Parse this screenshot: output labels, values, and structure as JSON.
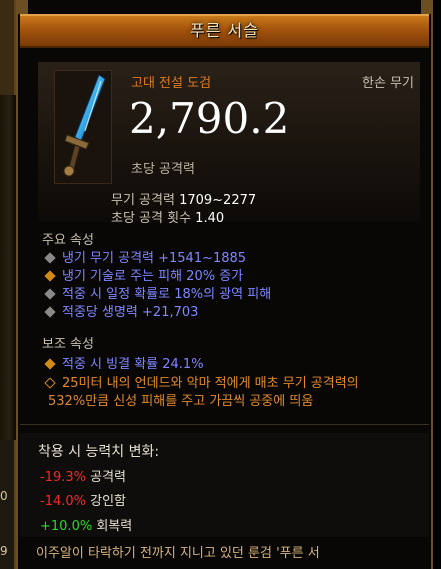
{
  "side_panel": {
    "digit_top": "0",
    "digit_bottom": "9"
  },
  "tooltip": {
    "title": "푸른 서슬",
    "item_type": "고대 전설 도검",
    "hand_type": "한손 무기",
    "dps_value": "2,790.2",
    "dps_label": "초당 공격력",
    "stats": [
      {
        "label": "무기 공격력",
        "value": "1709~2277"
      },
      {
        "label": "초당 공격 횟수",
        "value": "1.40"
      }
    ],
    "primary_title": "주요 속성",
    "primary": [
      "냉기 무기 공격력 +1541~1885",
      "냉기 기술로 주는 피해 20% 증가",
      "적중 시 일정 확률로 18%의 광역 피해",
      "적중당 생명력 +21,703"
    ],
    "secondary_title": "보조 속성",
    "secondary": [
      "적중 시 빙결 확률 24.1%",
      "25미터 내의 언데드와 악마 적에게 매초 무기 공격력의",
      "532%만큼 신성 피해를 주고 가끔씩 공중에 띄움"
    ],
    "change_title": "착용 시 능력치 변화:",
    "changes": [
      {
        "value": "-19.3%",
        "label": "공격력"
      },
      {
        "value": "-14.0%",
        "label": "강인함"
      },
      {
        "value": "+10.0%",
        "label": "회복력"
      }
    ],
    "flavor": "이주알이 타락하기 전까지 지니고 있던 룬검 '푸른 서"
  },
  "colors": {
    "header_orange": "#c97a1a",
    "legendary_orange": "#d97c23",
    "magic_blue": "#7f86ff",
    "negative": "#ee2a2a",
    "positive": "#22dd22"
  }
}
